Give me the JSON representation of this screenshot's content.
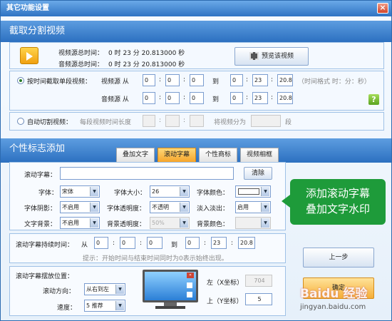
{
  "window": {
    "title": "其它功能设置",
    "close": "×"
  },
  "section1": {
    "title": "截取分割视频"
  },
  "info": {
    "video_total_label": "视频源总时间：",
    "video_total_value": "0 时 23 分 20.813000 秒",
    "audio_total_label": "音频源总时间：",
    "audio_total_value": "0 时 23 分 20.813000 秒",
    "preview_button": "预览该视频"
  },
  "time_cut": {
    "radio_label": "按时间截取单段视频：",
    "video_label": "视频源 从",
    "audio_label": "音频源 从",
    "to_label": "到",
    "from": [
      "0",
      "0",
      "0"
    ],
    "to": [
      "0",
      "23",
      "20.8"
    ],
    "format_hint": "（时间格式 时：分：秒）",
    "help": "?"
  },
  "auto_cut": {
    "radio_label": "自动切割视频：",
    "segment_label": "每段视频时间长度",
    "split_label": "将视频分为",
    "unit": "段"
  },
  "section2": {
    "title": "个性标志添加"
  },
  "tabs": [
    "叠加文字",
    "滚动字幕",
    "个性商标",
    "视频相框"
  ],
  "subtitle": {
    "label": "滚动字幕：",
    "value": "",
    "clear_button": "清除",
    "font_label": "字体：",
    "font_value": "宋体",
    "size_label": "字体大小：",
    "size_value": "26",
    "color_label": "字体颜色：",
    "shadow_label": "字体阴影：",
    "shadow_value": "不启用",
    "opacity_label": "字体透明度：",
    "opacity_value": "不透明",
    "fade_label": "淡入淡出：",
    "fade_value": "启用",
    "bg_label": "文字背景：",
    "bg_value": "不启用",
    "bg_opacity_label": "背景透明度：",
    "bg_opacity_value": "50%",
    "bg_color_label": "背景颜色："
  },
  "duration": {
    "label": "滚动字幕持续时间：",
    "from_label": "从",
    "to_label": "到",
    "from": [
      "0",
      "0",
      "0"
    ],
    "to": [
      "0",
      "23",
      "20.8"
    ],
    "hint": "提示：开始时间与结束时间同时为0表示始终出现。"
  },
  "position": {
    "label": "滚动字幕摆放位置：",
    "direction_label": "滚动方向：",
    "direction_value": "从右到左",
    "speed_label": "速度：",
    "speed_value": "5 推荐",
    "left_label": "左（X坐标）",
    "left_value": "704",
    "top_label": "上（Y坐标）",
    "top_value": "5"
  },
  "callout": {
    "line1": "添加滚动字幕",
    "line2": "叠加文字水印"
  },
  "buttons": {
    "prev": "上一步",
    "ok": "确定"
  },
  "watermark": {
    "logo": "Baidu 经验",
    "url": "jingyan.baidu.com"
  },
  "colors": {
    "accent": "#2f73c3",
    "callout": "#1e9b3a",
    "tab_active": "#f6a52b"
  }
}
